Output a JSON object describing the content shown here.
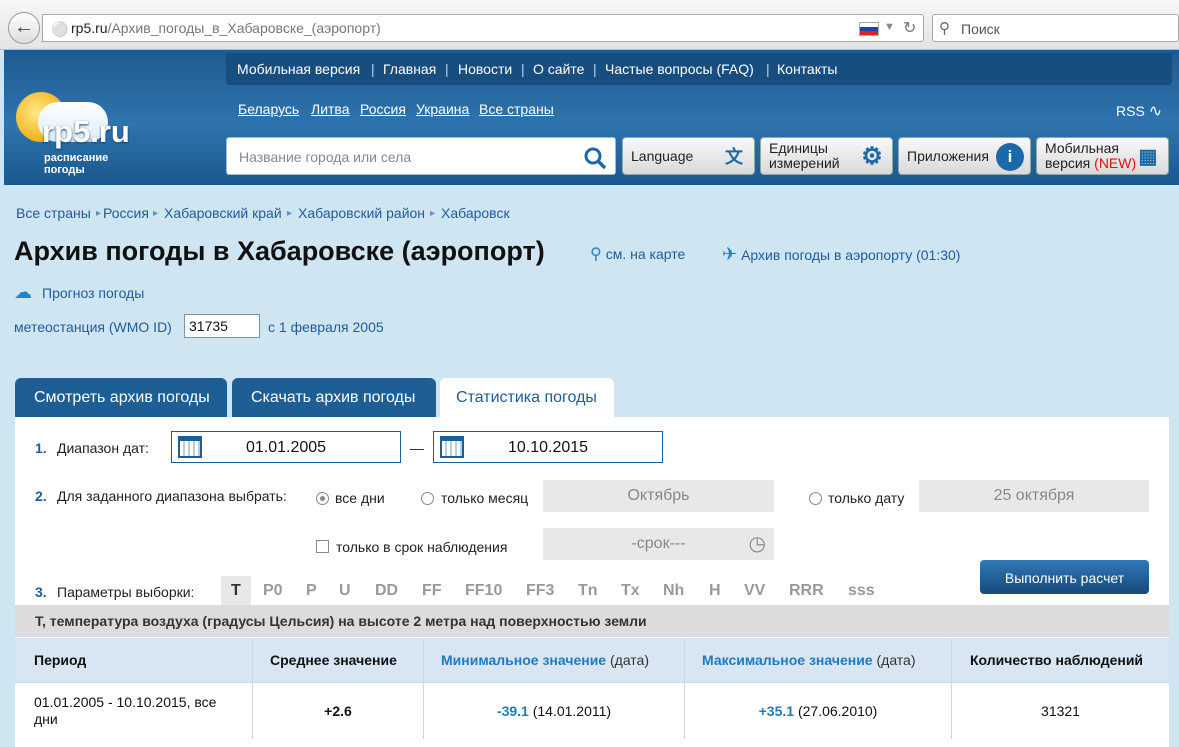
{
  "browser": {
    "url_host": "rp5.ru",
    "url_path": "/Архив_погоды_в_Хабаровске_(аэропорт)",
    "search_placeholder": "Поиск"
  },
  "topnav": [
    "Мобильная версия",
    "Главная",
    "Новости",
    "О сайте",
    "Частые вопросы (FAQ)",
    "Контакты"
  ],
  "logo": {
    "name": "rp5.ru",
    "tagline1": "расписание",
    "tagline2": "погоды"
  },
  "countries": [
    "Беларусь",
    "Литва",
    "Россия",
    "Украина",
    "Все страны"
  ],
  "rss": "RSS",
  "city_search_placeholder": "Название города или села",
  "header_buttons": {
    "language": "Language",
    "units_1": "Единицы",
    "units_2": "измерений",
    "apps": "Приложения",
    "mobile_1": "Мобильная",
    "mobile_2": "версия",
    "mobile_new": "(NEW)"
  },
  "breadcrumbs": [
    "Все страны",
    "Россия",
    "Хабаровский край",
    "Хабаровский район",
    "Хабаровск"
  ],
  "page_title": "Архив погоды в Хабаровске (аэропорт)",
  "map_link": "см. на карте",
  "airport_link": "Архив погоды в аэропорту (01:30)",
  "forecast_link": "Прогноз погоды",
  "station": {
    "label": "метеостанция (WMO ID)",
    "id": "31735",
    "since": "с 1 февраля 2005"
  },
  "tabs": [
    "Смотреть архив погоды",
    "Скачать архив погоды",
    "Статистика погоды"
  ],
  "form": {
    "step1_num": "1.",
    "step1_label": "Диапазон дат:",
    "date_from": "01.01.2005",
    "date_dash": "—",
    "date_to": "10.10.2015",
    "step2_num": "2.",
    "step2_label": "Для заданного диапазона выбрать:",
    "opt_all_days": "все дни",
    "opt_month": "только месяц",
    "month_value": "Октябрь",
    "opt_date": "только дату",
    "date_value": "25 октября",
    "opt_obs_time": "только в срок наблюдения",
    "obs_time_value": "-срок---",
    "step3_num": "3.",
    "step3_label": "Параметры выборки:",
    "params": [
      "T",
      "P0",
      "P",
      "U",
      "DD",
      "FF",
      "FF10",
      "FF3",
      "Tn",
      "Tx",
      "Nh",
      "H",
      "VV",
      "RRR",
      "sss"
    ],
    "run_button": "Выполнить расчет"
  },
  "param_description": "T, температура воздуха (градусы Цельсия) на высоте 2 метра над поверхностью земли",
  "table": {
    "headers": {
      "period": "Период",
      "avg": "Среднее значение",
      "min": "Минимальное значение",
      "min_suffix": "(дата)",
      "max": "Максимальное значение",
      "max_suffix": "(дата)",
      "count": "Количество наблюдений"
    },
    "row": {
      "period_1": "01.01.2005 - 10.10.2015, все",
      "period_2": "дни",
      "avg": "+2.6",
      "min": "-39.1",
      "min_date": "(14.01.2011)",
      "max": "+35.1",
      "max_date": "(27.06.2010)",
      "count": "31321"
    }
  }
}
